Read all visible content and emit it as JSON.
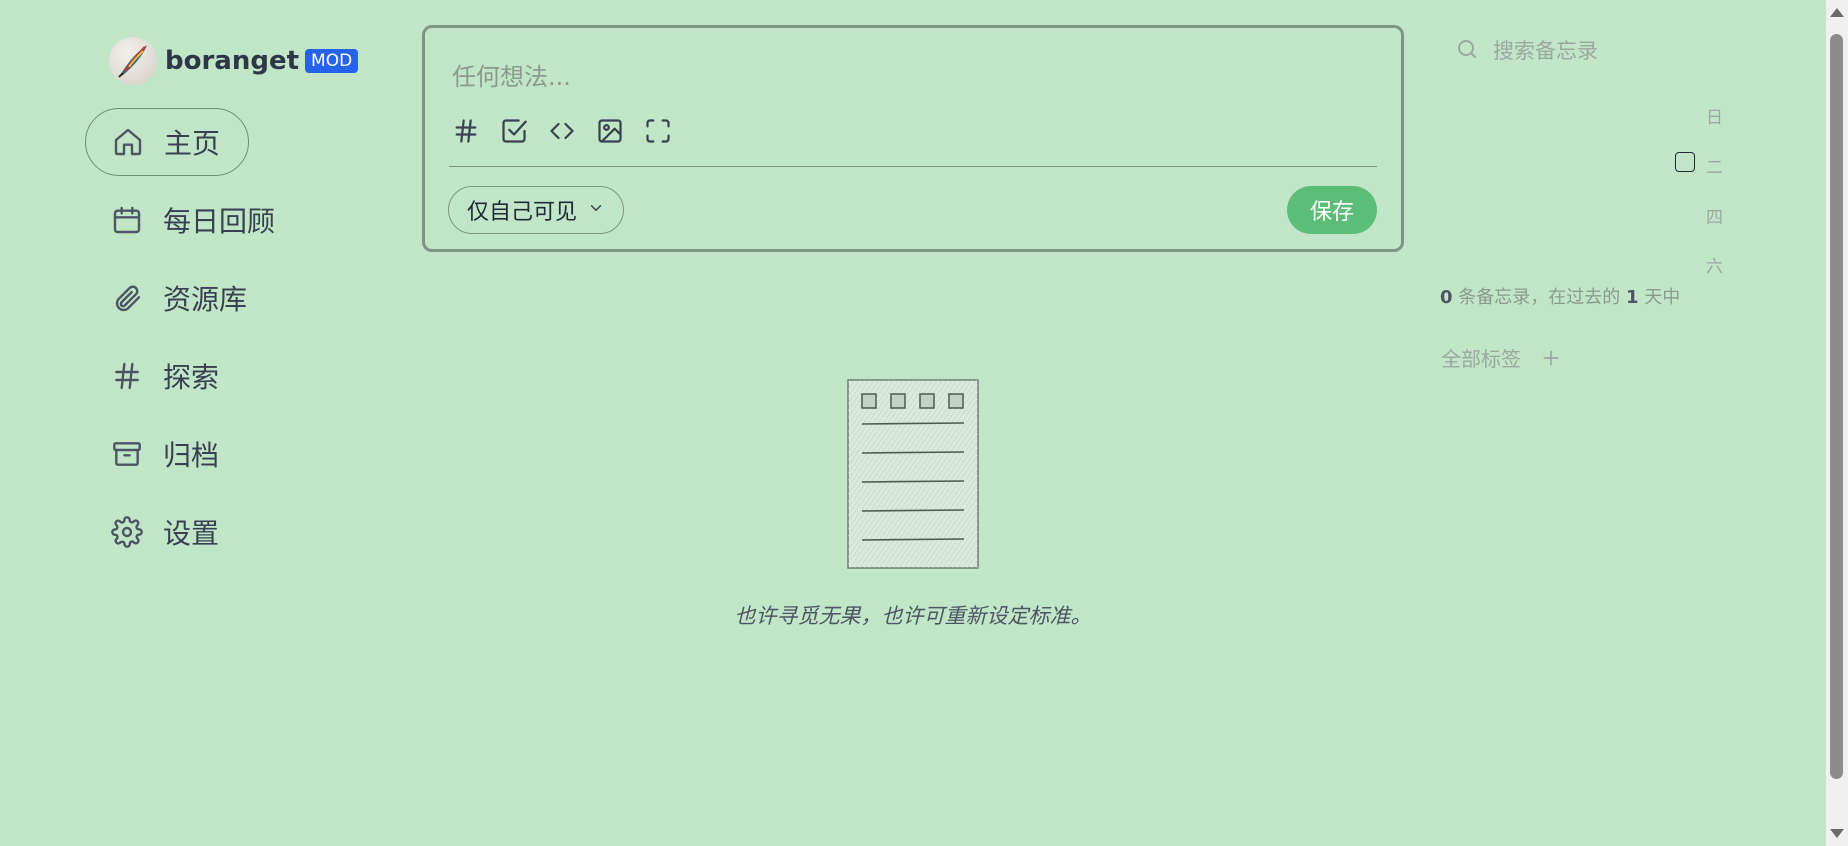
{
  "user": {
    "name": "boranget",
    "role": "MOD"
  },
  "nav": [
    {
      "label": "主页",
      "icon": "home-icon",
      "active": true
    },
    {
      "label": "每日回顾",
      "icon": "calendar-icon"
    },
    {
      "label": "资源库",
      "icon": "paperclip-icon"
    },
    {
      "label": "探索",
      "icon": "hash-icon"
    },
    {
      "label": "归档",
      "icon": "archive-icon"
    },
    {
      "label": "设置",
      "icon": "settings-icon"
    }
  ],
  "editor": {
    "placeholder": "任何想法...",
    "tools": [
      "hash-icon",
      "checkbox-icon",
      "code-icon",
      "image-icon",
      "fullscreen-icon"
    ],
    "visibility": "仅自己可见",
    "save_label": "保存"
  },
  "empty_state": {
    "text": "也许寻觅无果，也许可重新设定标准。"
  },
  "search": {
    "placeholder": "搜索备忘录"
  },
  "calendar": {
    "weekdays": [
      "日",
      "二",
      "四",
      "六"
    ]
  },
  "stats": {
    "count": "0",
    "middle": " 条备忘录，在过去的 ",
    "days": "1",
    "suffix": " 天中"
  },
  "tags": {
    "label": "全部标签"
  },
  "colors": {
    "background": "#c1e6c7",
    "save_button": "#5cbd78",
    "role_badge": "#2563eb"
  }
}
